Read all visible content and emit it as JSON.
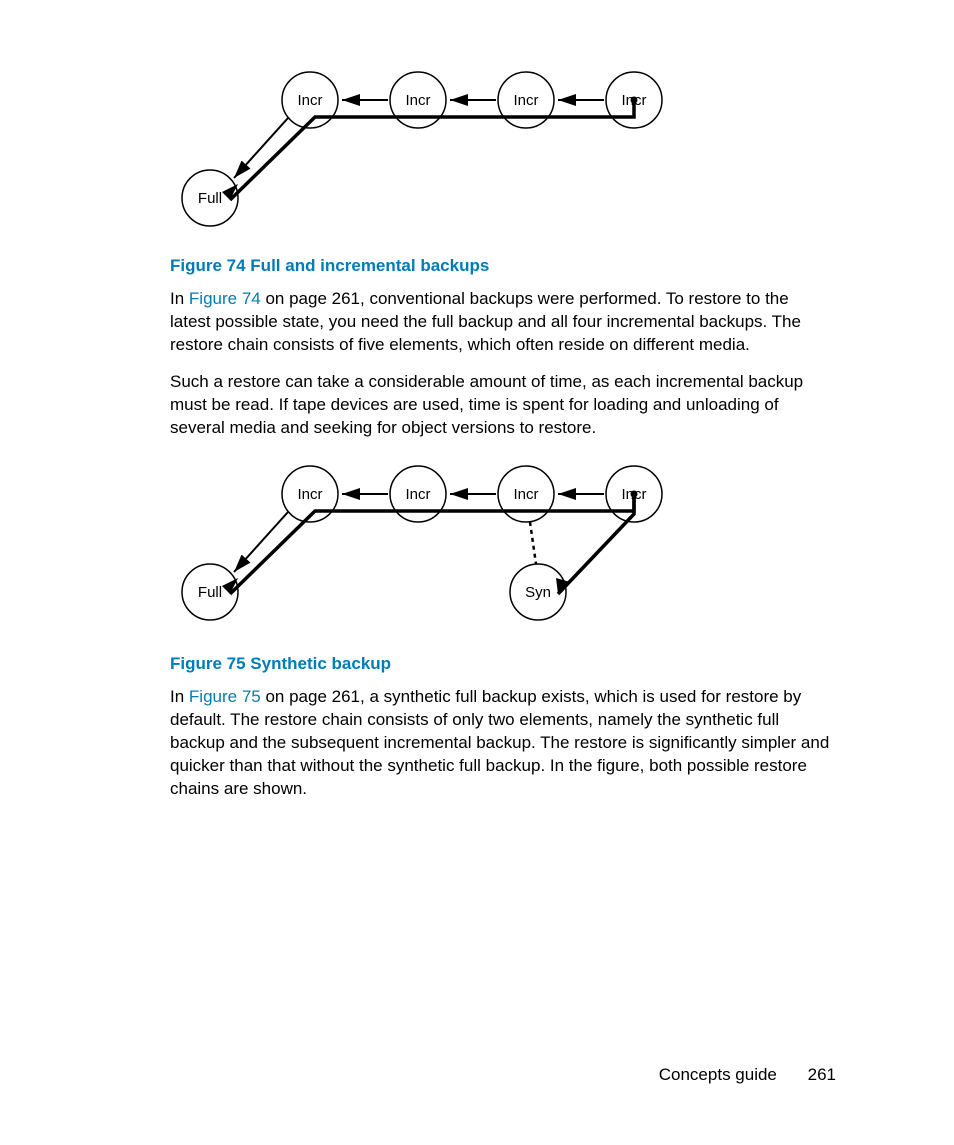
{
  "diagram1": {
    "nodes": [
      "Incr",
      "Incr",
      "Incr",
      "Incr",
      "Full"
    ]
  },
  "fig74": {
    "title": "Figure 74 Full and incremental backups"
  },
  "para1": {
    "prefix": "In ",
    "link": "Figure 74",
    "rest": " on page 261, conventional backups were performed. To restore to the latest possible state, you need the full backup and all four incremental backups. The restore chain consists of five elements, which often reside on different media."
  },
  "para2": "Such a restore can take a considerable amount of time, as each incremental backup must be read. If tape devices are used, time is spent for loading and unloading of several media and seeking for object versions to restore.",
  "diagram2": {
    "nodes": [
      "Incr",
      "Incr",
      "Incr",
      "Incr",
      "Full",
      "Syn"
    ]
  },
  "fig75": {
    "title": "Figure 75 Synthetic backup"
  },
  "para3": {
    "prefix": "In ",
    "link": "Figure 75",
    "rest": " on page 261, a synthetic full backup exists, which is used for restore by default. The restore chain consists of only two elements, namely the synthetic full backup and the subsequent incremental backup. The restore is significantly simpler and quicker than that without the synthetic full backup. In the figure, both possible restore chains are shown."
  },
  "footer": {
    "label": "Concepts guide",
    "page": "261"
  }
}
